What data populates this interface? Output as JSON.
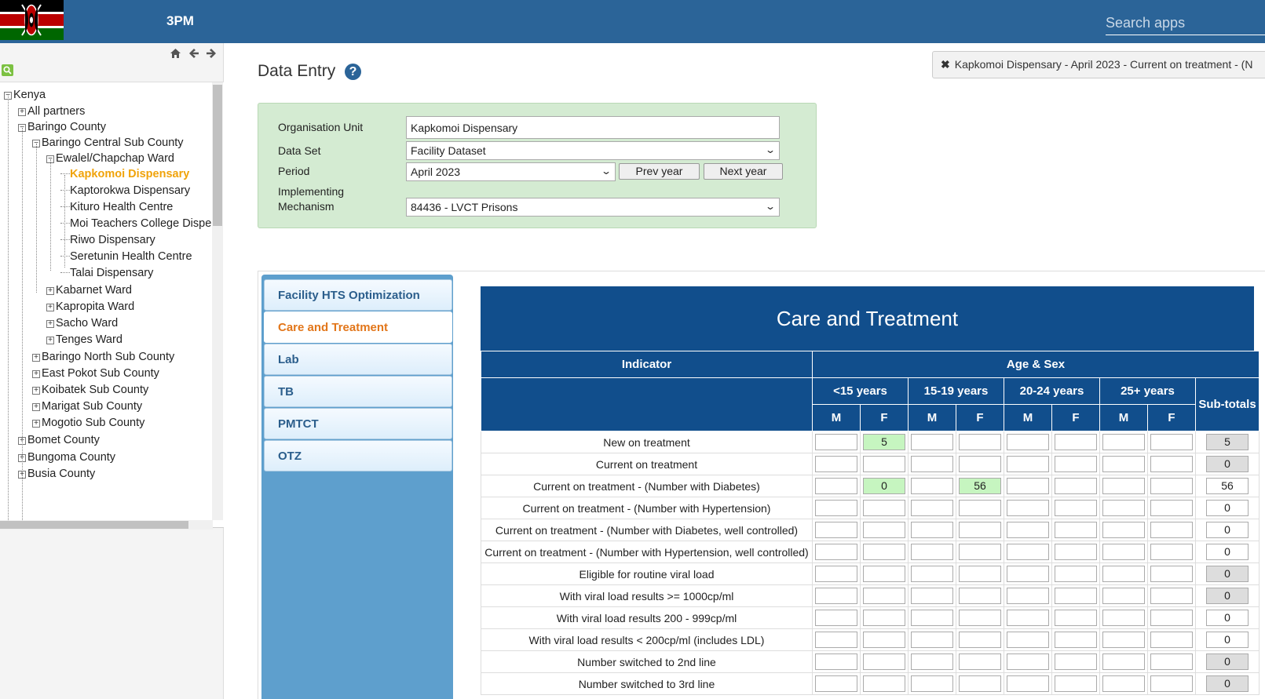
{
  "header": {
    "app_title": "3PM",
    "search_placeholder": "Search apps"
  },
  "tree": {
    "nodes": [
      {
        "label": "Kenya",
        "expander": "−"
      },
      {
        "label": "All partners",
        "expander": "+"
      },
      {
        "label": "Baringo County",
        "expander": "−"
      },
      {
        "label": "Baringo Central Sub County",
        "expander": "−"
      },
      {
        "label": "Ewalel/Chapchap Ward",
        "expander": "−"
      },
      {
        "label": "Kapkomoi Dispensary",
        "expander": ""
      },
      {
        "label": "Kaptorokwa Dispensary",
        "expander": ""
      },
      {
        "label": "Kituro Health Centre",
        "expander": ""
      },
      {
        "label": "Moi Teachers College Dispe",
        "expander": ""
      },
      {
        "label": "Riwo Dispensary",
        "expander": ""
      },
      {
        "label": "Seretunin Health Centre",
        "expander": ""
      },
      {
        "label": "Talai Dispensary",
        "expander": ""
      },
      {
        "label": "Kabarnet Ward",
        "expander": "+"
      },
      {
        "label": "Kapropita Ward",
        "expander": "+"
      },
      {
        "label": "Sacho Ward",
        "expander": "+"
      },
      {
        "label": "Tenges Ward",
        "expander": "+"
      },
      {
        "label": "Baringo North Sub County",
        "expander": "+"
      },
      {
        "label": "East Pokot Sub County",
        "expander": "+"
      },
      {
        "label": "Koibatek Sub County",
        "expander": "+"
      },
      {
        "label": "Marigat Sub County",
        "expander": "+"
      },
      {
        "label": "Mogotio Sub County",
        "expander": "+"
      },
      {
        "label": "Bomet County",
        "expander": "+"
      },
      {
        "label": "Bungoma County",
        "expander": "+"
      },
      {
        "label": "Busia County",
        "expander": "+"
      }
    ],
    "selected": "Kapkomoi Dispensary"
  },
  "page": {
    "title": "Data Entry",
    "help": "?"
  },
  "notice": {
    "text": "Kapkomoi Dispensary - April 2023 - Current on treatment - (N",
    "close": "✖"
  },
  "form": {
    "org_unit_label": "Organisation Unit",
    "org_unit_value": "Kapkomoi Dispensary",
    "dataset_label": "Data Set",
    "dataset_value": "Facility Dataset",
    "period_label": "Period",
    "period_value": "April 2023",
    "prev_year": "Prev year",
    "next_year": "Next year",
    "mechanism_label_1": "Implementing",
    "mechanism_label_2": "Mechanism",
    "mechanism_value": "84436 - LVCT Prisons"
  },
  "tabs": [
    "Facility HTS Optimization",
    "Care and Treatment",
    "Lab",
    "TB",
    "PMTCT",
    "OTZ"
  ],
  "active_tab": "Care and Treatment",
  "grid": {
    "title": "Care and Treatment",
    "indicator_header": "Indicator",
    "agesex_header": "Age & Sex",
    "age_groups": [
      "<15 years",
      "15-19 years",
      "20-24 years",
      "25+ years"
    ],
    "sexes": [
      "M",
      "F",
      "M",
      "F",
      "M",
      "F",
      "M",
      "F"
    ],
    "subtotals_header": "Sub-totals",
    "rows": [
      {
        "label": "New on treatment",
        "cells": [
          "",
          "5",
          "",
          "",
          "",
          "",
          "",
          ""
        ],
        "subtotal": "5",
        "subtotal_grey": true
      },
      {
        "label": "Current on treatment",
        "cells": [
          "",
          "",
          "",
          "",
          "",
          "",
          "",
          ""
        ],
        "subtotal": "0",
        "subtotal_grey": true
      },
      {
        "label": "Current on treatment - (Number with Diabetes)",
        "cells": [
          "",
          "0",
          "",
          "56",
          "",
          "",
          "",
          ""
        ],
        "subtotal": "56",
        "subtotal_grey": false
      },
      {
        "label": "Current on treatment - (Number with Hypertension)",
        "cells": [
          "",
          "",
          "",
          "",
          "",
          "",
          "",
          ""
        ],
        "subtotal": "0",
        "subtotal_grey": false
      },
      {
        "label": "Current on treatment - (Number with Diabetes, well controlled)",
        "cells": [
          "",
          "",
          "",
          "",
          "",
          "",
          "",
          ""
        ],
        "subtotal": "0",
        "subtotal_grey": false
      },
      {
        "label": "Current on treatment - (Number with Hypertension, well controlled)",
        "cells": [
          "",
          "",
          "",
          "",
          "",
          "",
          "",
          ""
        ],
        "subtotal": "0",
        "subtotal_grey": false
      },
      {
        "label": "Eligible for routine viral load",
        "cells": [
          "",
          "",
          "",
          "",
          "",
          "",
          "",
          ""
        ],
        "subtotal": "0",
        "subtotal_grey": true
      },
      {
        "label": "With viral load results >= 1000cp/ml",
        "cells": [
          "",
          "",
          "",
          "",
          "",
          "",
          "",
          ""
        ],
        "subtotal": "0",
        "subtotal_grey": true
      },
      {
        "label": "With viral load results 200 - 999cp/ml",
        "cells": [
          "",
          "",
          "",
          "",
          "",
          "",
          "",
          ""
        ],
        "subtotal": "0",
        "subtotal_grey": false
      },
      {
        "label": "With viral load results < 200cp/ml (includes LDL)",
        "cells": [
          "",
          "",
          "",
          "",
          "",
          "",
          "",
          ""
        ],
        "subtotal": "0",
        "subtotal_grey": false
      },
      {
        "label": "Number switched to 2nd line",
        "cells": [
          "",
          "",
          "",
          "",
          "",
          "",
          "",
          ""
        ],
        "subtotal": "0",
        "subtotal_grey": true
      },
      {
        "label": "Number switched to 3rd line",
        "cells": [
          "",
          "",
          "",
          "",
          "",
          "",
          "",
          ""
        ],
        "subtotal": "0",
        "subtotal_grey": true
      }
    ]
  }
}
